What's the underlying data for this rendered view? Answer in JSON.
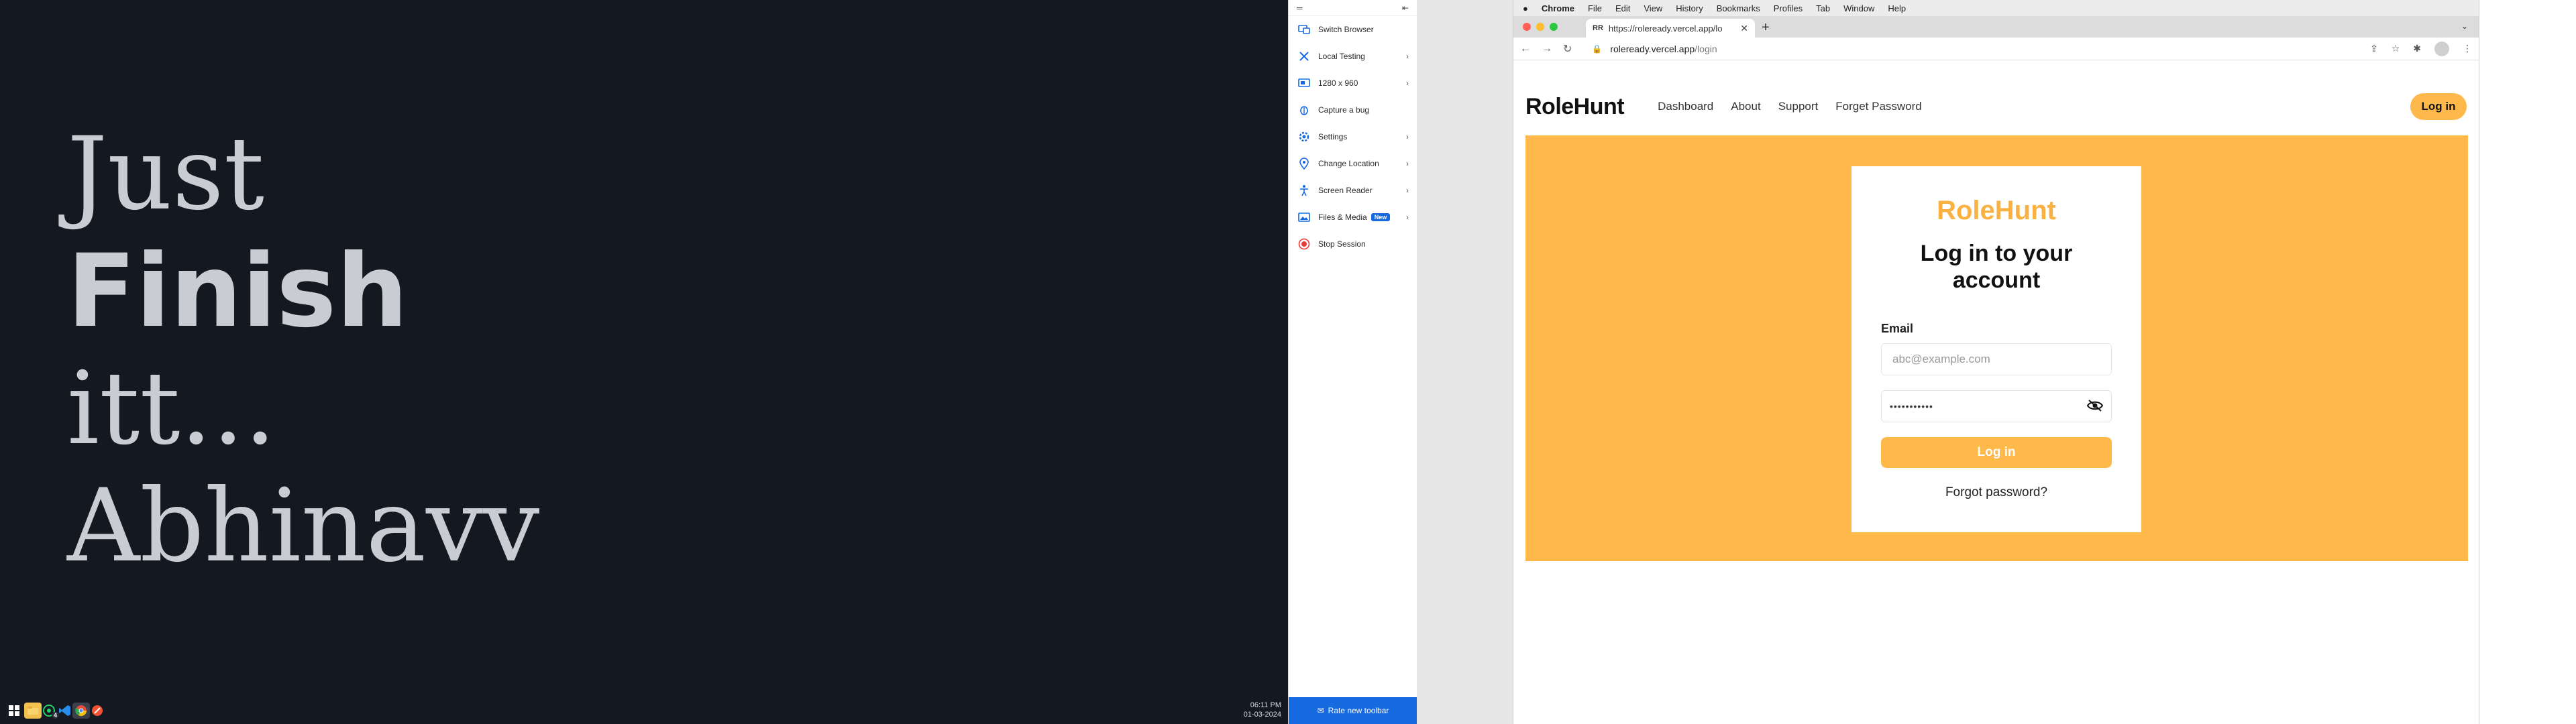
{
  "desktop": {
    "quote_lines": [
      "Just",
      "Finish",
      "itt...",
      "Abhinavv"
    ]
  },
  "taskbar": {
    "time": "06:11 PM",
    "date": "01-03-2024",
    "icons": [
      "windows-start-icon",
      "file-explorer-icon",
      "whatsapp-icon",
      "vscode-icon",
      "chrome-icon",
      "git-icon"
    ],
    "whatsapp_badge": "4"
  },
  "toolbar": {
    "items": [
      {
        "label": "Switch Browser",
        "icon": "switch-browser-icon",
        "chevron": false
      },
      {
        "label": "Local Testing",
        "icon": "local-testing-icon",
        "chevron": true
      },
      {
        "label": "1280 x 960",
        "icon": "resolution-icon",
        "chevron": true
      },
      {
        "label": "Capture a bug",
        "icon": "bug-icon",
        "chevron": false
      },
      {
        "label": "Settings",
        "icon": "settings-icon",
        "chevron": true
      },
      {
        "label": "Change Location",
        "icon": "location-icon",
        "chevron": true
      },
      {
        "label": "Screen Reader",
        "icon": "accessibility-icon",
        "chevron": true
      },
      {
        "label": "Files & Media",
        "icon": "files-icon",
        "chevron": true,
        "badge": "New"
      },
      {
        "label": "Stop Session",
        "icon": "stop-icon",
        "chevron": false
      }
    ],
    "rate_label": "Rate new toolbar"
  },
  "mac": {
    "menu": [
      "Chrome",
      "File",
      "Edit",
      "View",
      "History",
      "Bookmarks",
      "Profiles",
      "Tab",
      "Window",
      "Help"
    ],
    "tab_title": "https://roleready.vercel.app/lo",
    "url_host": "roleready.vercel.app",
    "url_path": "/login"
  },
  "site": {
    "logo": "RoleHunt",
    "nav_links": [
      "Dashboard",
      "About",
      "Support",
      "Forget Password"
    ],
    "nav_login": "Log in",
    "card": {
      "brand": "RoleHunt",
      "title": "Log in to your account",
      "email_label": "Email",
      "email_placeholder": "abc@example.com",
      "password_mask": "•••••••••••",
      "login_button": "Log in",
      "forgot": "Forgot password?"
    }
  },
  "colors": {
    "accent": "#ffb84a",
    "brand_text": "#f9b242",
    "toolbar_blue": "#1769e0",
    "desktop_bg": "#141821"
  }
}
